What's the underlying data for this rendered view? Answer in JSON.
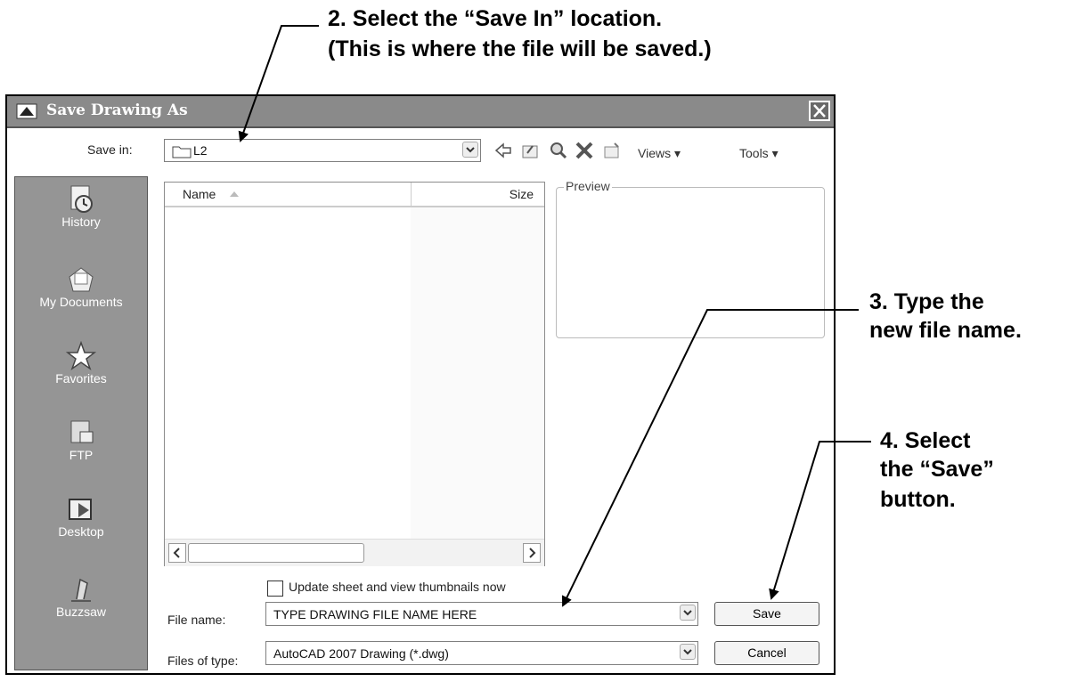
{
  "callouts": {
    "c2_line1": "2.  Select the “Save In” location.",
    "c2_line2": "(This is where the file will be saved.)",
    "c3_line1": "3.  Type the",
    "c3_line2": "new file name.",
    "c4_line1": "4.  Select",
    "c4_line2": "the “Save”",
    "c4_line3": "button."
  },
  "dialog": {
    "title": "Save Drawing As",
    "save_in_label": "Save in:",
    "save_in_value": "L2",
    "toolbar": {
      "views": "Views",
      "tools": "Tools"
    },
    "places": [
      "History",
      "My Documents",
      "Favorites",
      "FTP",
      "Desktop",
      "Buzzsaw"
    ],
    "columns": {
      "name": "Name",
      "size": "Size"
    },
    "preview_label": "Preview",
    "thumbnail_checkbox": "Update sheet and view thumbnails now",
    "file_name_label": "File name:",
    "file_name_value": "TYPE DRAWING FILE NAME HERE",
    "file_type_label": "Files of type:",
    "file_type_value": "AutoCAD 2007 Drawing (*.dwg)",
    "save_button": "Save",
    "cancel_button": "Cancel"
  }
}
